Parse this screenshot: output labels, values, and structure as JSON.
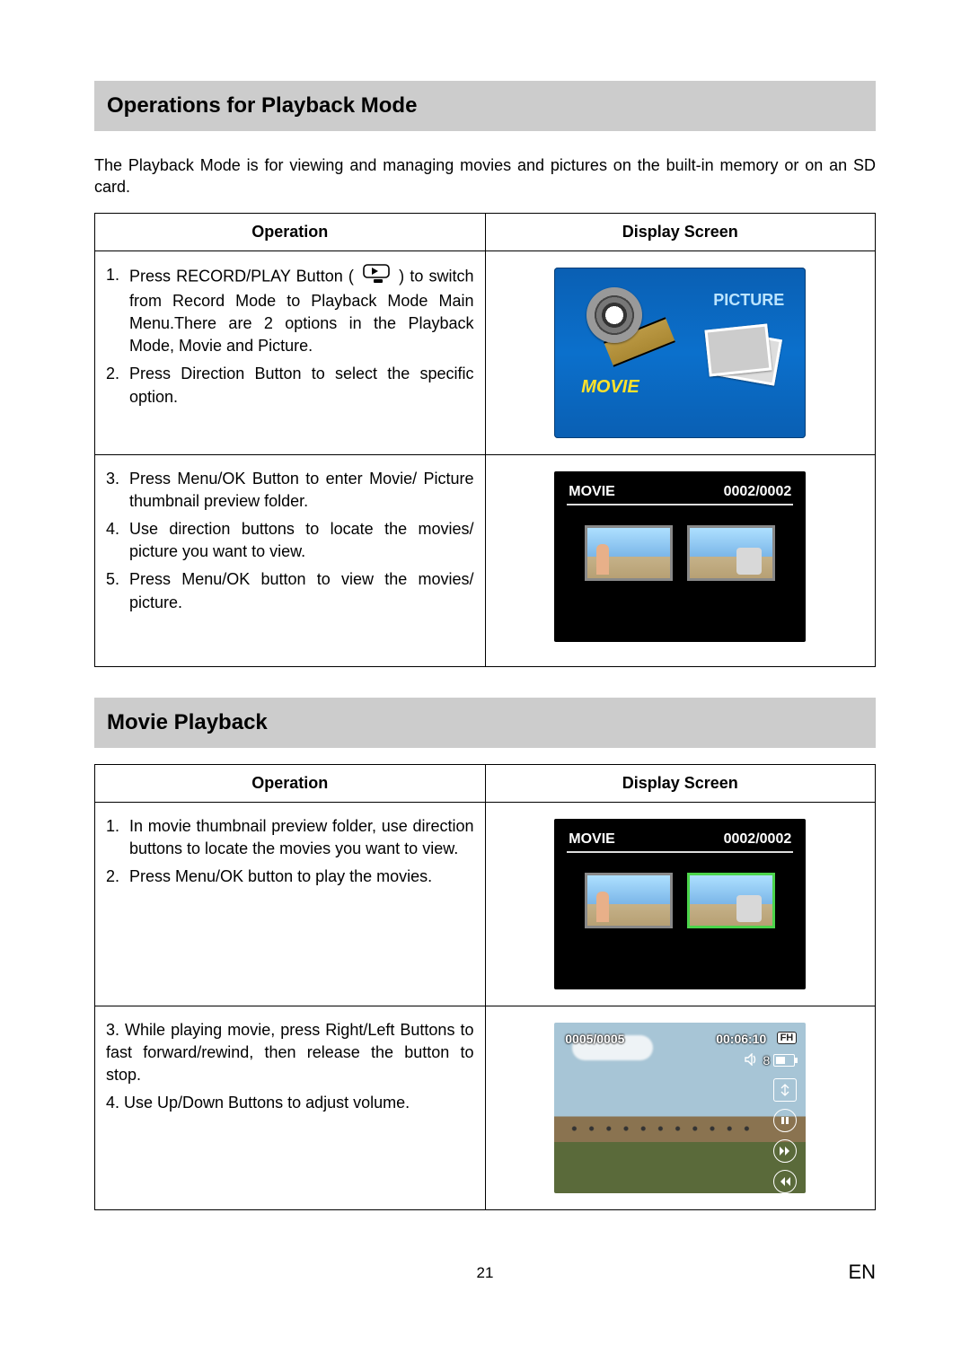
{
  "section1": {
    "title": "Operations for Playback Mode",
    "intro": "The Playback Mode is for viewing and managing movies and pictures on the built-in memory or on an SD card.",
    "headers": {
      "op": "Operation",
      "disp": "Display Screen"
    },
    "row1": {
      "items": [
        {
          "n": "1.",
          "pre": "Press RECORD/PLAY Button ( ",
          "post": " ) to switch from Record Mode to Playback Mode Main Menu.There are 2 options in the Playback Mode, Movie and Picture."
        },
        {
          "n": "2.",
          "t": "Press Direction Button to select the specific option."
        }
      ],
      "screen": {
        "movie": "MOVIE",
        "picture": "PICTURE"
      }
    },
    "row2": {
      "items": [
        {
          "n": "3.",
          "t": "Press Menu/OK Button to enter Movie/ Picture thumbnail preview folder."
        },
        {
          "n": "4.",
          "t": "Use direction buttons to locate the movies/ picture you want to view."
        },
        {
          "n": "5.",
          "t": "Press Menu/OK button to view the movies/ picture."
        }
      ],
      "screen": {
        "title": "MOVIE",
        "counter": "0002/0002"
      }
    }
  },
  "section2": {
    "title": "Movie Playback",
    "headers": {
      "op": "Operation",
      "disp": "Display Screen"
    },
    "row1": {
      "items": [
        {
          "n": "1.",
          "t": "In movie thumbnail preview folder, use direction buttons to locate the movies you want to view."
        },
        {
          "n": "2.",
          "t": "Press Menu/OK button to play the movies."
        }
      ],
      "screen": {
        "title": "MOVIE",
        "counter": "0002/0002"
      }
    },
    "row2": {
      "items": [
        {
          "n": "",
          "t": "3. While playing movie, press Right/Left Buttons to fast forward/rewind, then release the button to stop."
        },
        {
          "n": "",
          "t": "4. Use Up/Down Buttons to adjust volume."
        }
      ],
      "screen": {
        "index": "0005/0005",
        "time": "00:06:10",
        "fh": "FH",
        "vol": "8"
      }
    }
  },
  "footer": {
    "page": "21",
    "lang": "EN"
  }
}
